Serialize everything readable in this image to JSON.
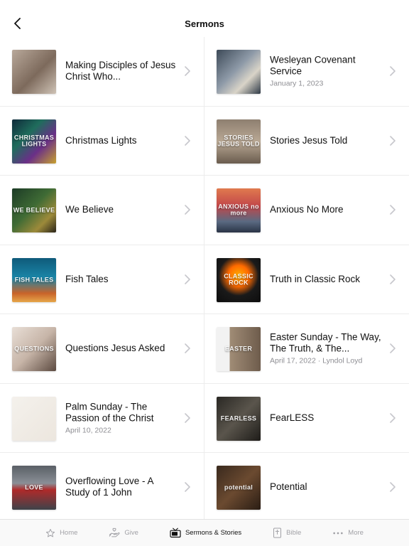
{
  "header": {
    "title": "Sermons",
    "back_icon": "chevron-left-icon"
  },
  "sermons": [
    {
      "title": "Making Disciples of Jesus Christ Who...",
      "subtitle": "",
      "thumb": {
        "bg": "linear-gradient(135deg,#b8a89a 0%,#7d6a5c 55%,#cfc3b6 100%)",
        "text": ""
      }
    },
    {
      "title": "Wesleyan Covenant Service",
      "subtitle": "January 1, 2023",
      "thumb": {
        "bg": "linear-gradient(135deg,#3d4a58 0%,#8e9aa8 45%,#d9d4c8 70%,#2f3a46 100%)",
        "text": ""
      }
    },
    {
      "title": "Christmas Lights",
      "subtitle": "",
      "thumb": {
        "bg": "linear-gradient(135deg,#0f2a3a 0%,#1f6d5c 35%,#6a2f88 65%,#c8a12e 100%)",
        "text": "CHRISTMAS LIGHTS"
      }
    },
    {
      "title": "Stories Jesus Told",
      "subtitle": "",
      "thumb": {
        "bg": "linear-gradient(180deg,#8e7f70 0%,#b9a894 50%,#6a5c4e 100%)",
        "text": "STORIES JESUS TOLD"
      }
    },
    {
      "title": "We Believe",
      "subtitle": "",
      "thumb": {
        "bg": "linear-gradient(135deg,#1c3b26 0%,#3f6b35 45%,#9c8a3a 75%,#2a2418 100%)",
        "text": "WE BELIEVE"
      }
    },
    {
      "title": "Anxious No More",
      "subtitle": "",
      "thumb": {
        "bg": "linear-gradient(180deg,#e07a4e 0%,#c2474a 40%,#5a6a82 75%,#2a3446 100%)",
        "text": "ANXIOUS no more"
      }
    },
    {
      "title": "Fish Tales",
      "subtitle": "",
      "thumb": {
        "bg": "linear-gradient(180deg,#0f5a7a 0%,#1a86a8 45%,#c9632a 80%,#e6a64a 100%)",
        "text": "FISH TALES"
      }
    },
    {
      "title": "Truth in Classic Rock",
      "subtitle": "",
      "thumb": {
        "bg": "radial-gradient(circle at 50% 40%,#ffb000 0%,#ff6a00 30%,#1a1a1a 58%,#0d0d0d 100%)",
        "text": "CLASSIC ROCK"
      }
    },
    {
      "title": "Questions Jesus Asked",
      "subtitle": "",
      "thumb": {
        "bg": "linear-gradient(135deg,#e8ded6 0%,#c7b5a8 50%,#5c4a40 100%)",
        "text": "QUESTIONS"
      }
    },
    {
      "title": "Easter Sunday  - The Way, The Truth, & The...",
      "subtitle": "April 17, 2022 · Lyndol Loyd",
      "thumb": {
        "bg": "linear-gradient(90deg,#f2f2f2 0%,#f2f2f2 30%,#a08c76 30%,#6e5c4c 100%)",
        "text": "EASTER"
      }
    },
    {
      "title": "Palm Sunday - The Passion of the Christ",
      "subtitle": "April 10, 2022",
      "thumb": {
        "bg": "linear-gradient(135deg,#f4f1ec 0%,#ece6de 100%)",
        "text": ""
      }
    },
    {
      "title": "FearLESS",
      "subtitle": "",
      "thumb": {
        "bg": "linear-gradient(135deg,#2a2824 0%,#5a554c 50%,#1e1c19 100%)",
        "text": "FEARLESS"
      }
    },
    {
      "title": "Overflowing Love - A Study of 1 John",
      "subtitle": "",
      "thumb": {
        "bg": "linear-gradient(180deg,#5a5f66 0%,#8a8f96 40%,#b02a2a 55%,#3e434a 100%)",
        "text": "LOVE"
      }
    },
    {
      "title": "Potential",
      "subtitle": "",
      "thumb": {
        "bg": "linear-gradient(135deg,#3a2a1e 0%,#6b4a30 50%,#2a1d14 100%)",
        "text": "potential"
      }
    }
  ],
  "tabs": [
    {
      "label": "Home",
      "icon": "star-icon",
      "active": false
    },
    {
      "label": "Give",
      "icon": "hand-heart-icon",
      "active": false
    },
    {
      "label": "Sermons & Stories",
      "icon": "tv-icon",
      "active": true
    },
    {
      "label": "Bible",
      "icon": "bible-icon",
      "active": false
    },
    {
      "label": "More",
      "icon": "ellipsis-icon",
      "active": false
    }
  ]
}
